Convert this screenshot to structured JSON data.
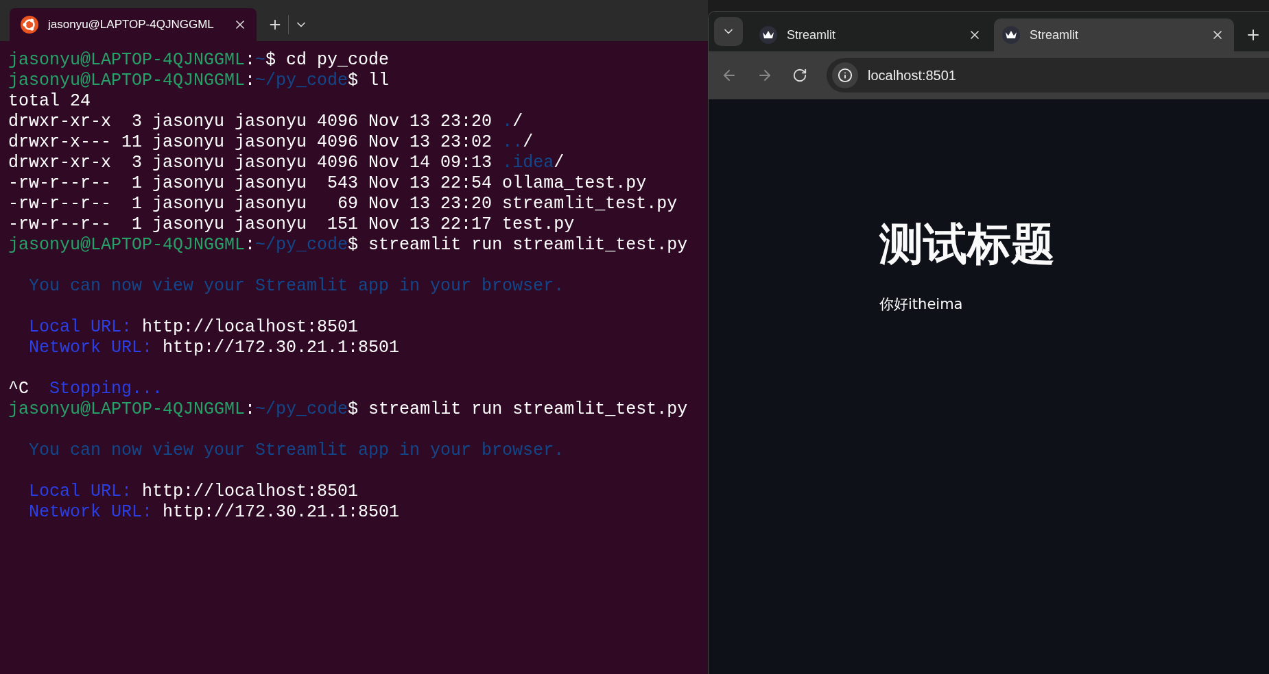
{
  "terminal": {
    "tab": {
      "title": "jasonyu@LAPTOP-4QJNGGML",
      "selected": true
    },
    "lines": [
      {
        "kind": "text",
        "segments": [
          {
            "text": "jasonyu@LAPTOP-4QJNGGML",
            "kind": "user"
          },
          {
            "text": ":",
            "kind": "plain"
          },
          {
            "text": "~",
            "kind": "path"
          },
          {
            "text": "$ cd py_code",
            "kind": "plain"
          }
        ]
      },
      {
        "kind": "text",
        "segments": [
          {
            "text": "jasonyu@LAPTOP-4QJNGGML",
            "kind": "user"
          },
          {
            "text": ":",
            "kind": "plain"
          },
          {
            "text": "~/py_code",
            "kind": "path"
          },
          {
            "text": "$ ll",
            "kind": "plain"
          }
        ]
      },
      {
        "kind": "text",
        "segments": [
          {
            "text": "total 24",
            "kind": "plain"
          }
        ]
      },
      {
        "kind": "text",
        "segments": [
          {
            "text": "drwxr-xr-x  3 jasonyu jasonyu 4096 Nov 13 23:20 ",
            "kind": "plain"
          },
          {
            "text": ".",
            "kind": "path"
          },
          {
            "text": "/",
            "kind": "plain"
          }
        ]
      },
      {
        "kind": "text",
        "segments": [
          {
            "text": "drwxr-x--- 11 jasonyu jasonyu 4096 Nov 13 23:02 ",
            "kind": "plain"
          },
          {
            "text": "..",
            "kind": "path"
          },
          {
            "text": "/",
            "kind": "plain"
          }
        ]
      },
      {
        "kind": "text",
        "segments": [
          {
            "text": "drwxr-xr-x  3 jasonyu jasonyu 4096 Nov 14 09:13 ",
            "kind": "plain"
          },
          {
            "text": ".idea",
            "kind": "path"
          },
          {
            "text": "/",
            "kind": "plain"
          }
        ]
      },
      {
        "kind": "text",
        "segments": [
          {
            "text": "-rw-r--r--  1 jasonyu jasonyu  543 Nov 13 22:54 ollama_test.py",
            "kind": "plain"
          }
        ]
      },
      {
        "kind": "text",
        "segments": [
          {
            "text": "-rw-r--r--  1 jasonyu jasonyu   69 Nov 13 23:20 streamlit_test.py",
            "kind": "plain"
          }
        ]
      },
      {
        "kind": "text",
        "segments": [
          {
            "text": "-rw-r--r--  1 jasonyu jasonyu  151 Nov 13 22:17 test.py",
            "kind": "plain"
          }
        ]
      },
      {
        "kind": "text",
        "segments": [
          {
            "text": "jasonyu@LAPTOP-4QJNGGML",
            "kind": "user"
          },
          {
            "text": ":",
            "kind": "plain"
          },
          {
            "text": "~/py_code",
            "kind": "path"
          },
          {
            "text": "$ streamlit run streamlit_test.py",
            "kind": "plain"
          }
        ]
      },
      {
        "kind": "blank"
      },
      {
        "kind": "text",
        "segments": [
          {
            "text": "  You can now view your Streamlit app in your browser.",
            "kind": "info"
          }
        ]
      },
      {
        "kind": "blank"
      },
      {
        "kind": "text",
        "segments": [
          {
            "text": "  Local URL: ",
            "kind": "label"
          },
          {
            "text": "http://localhost:8501",
            "kind": "plain"
          }
        ]
      },
      {
        "kind": "text",
        "segments": [
          {
            "text": "  Network URL: ",
            "kind": "label"
          },
          {
            "text": "http://172.30.21.1:8501",
            "kind": "plain"
          }
        ]
      },
      {
        "kind": "blank"
      },
      {
        "kind": "text",
        "segments": [
          {
            "text": "^C  ",
            "kind": "plain"
          },
          {
            "text": "Stopping...",
            "kind": "label"
          }
        ]
      },
      {
        "kind": "text",
        "segments": [
          {
            "text": "jasonyu@LAPTOP-4QJNGGML",
            "kind": "user"
          },
          {
            "text": ":",
            "kind": "plain"
          },
          {
            "text": "~/py_code",
            "kind": "path"
          },
          {
            "text": "$ streamlit run streamlit_test.py",
            "kind": "plain"
          }
        ]
      },
      {
        "kind": "blank"
      },
      {
        "kind": "text",
        "segments": [
          {
            "text": "  You can now view your Streamlit app in your browser.",
            "kind": "info"
          }
        ]
      },
      {
        "kind": "blank"
      },
      {
        "kind": "text",
        "segments": [
          {
            "text": "  Local URL: ",
            "kind": "label"
          },
          {
            "text": "http://localhost:8501",
            "kind": "plain"
          }
        ]
      },
      {
        "kind": "text",
        "segments": [
          {
            "text": "  Network URL: ",
            "kind": "label"
          },
          {
            "text": "http://172.30.21.1:8501",
            "kind": "plain"
          }
        ]
      }
    ]
  },
  "browser": {
    "tabs": [
      {
        "title": "Streamlit",
        "selected": false
      },
      {
        "title": "Streamlit",
        "selected": true
      }
    ],
    "address": "localhost:8501",
    "page": {
      "title": "测试标题",
      "text": "你好itheima"
    }
  }
}
